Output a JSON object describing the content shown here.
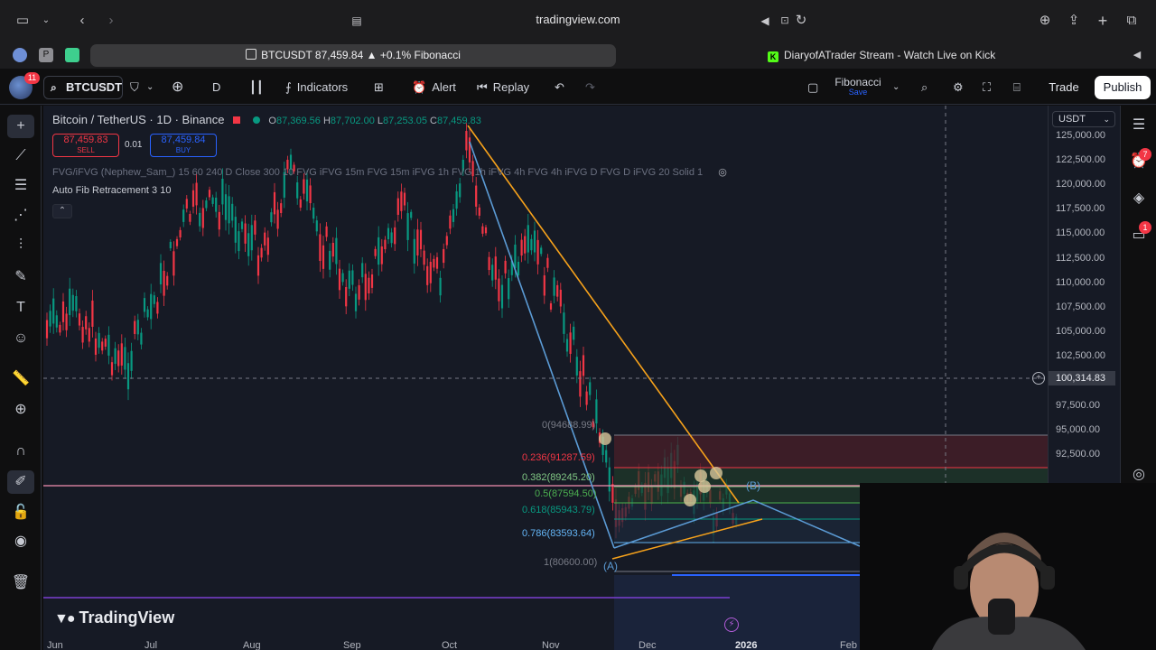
{
  "browser": {
    "url": "tradingview.com",
    "active_tab": "BTCUSDT 87,459.84 ▲ +0.1% Fibonacci",
    "second_tab": "DiaryofATrader Stream - Watch Live on Kick",
    "pinned_tabs": [
      "P"
    ]
  },
  "toolbar": {
    "notifications": "11",
    "symbol": "BTCUSDT",
    "interval": "D",
    "indicators": "Indicators",
    "alert": "Alert",
    "replay": "Replay",
    "layout_name": "Fibonacci",
    "layout_save": "Save",
    "trade": "Trade",
    "publish": "Publish"
  },
  "legend": {
    "title": "Bitcoin / TetherUS · 1D · Binance",
    "open": "87,369.56",
    "high": "87,702.00",
    "low": "87,253.05",
    "close": "87,459.83",
    "o_label": "O",
    "h_label": "H",
    "l_label": "L",
    "c_label": "C",
    "sell_price": "87,459.83",
    "sell_label": "SELL",
    "buy_price": "87,459.84",
    "buy_label": "BUY",
    "spread": "0.01",
    "indicator_1": "FVG/iFVG (Nephew_Sam_) 15 60 240 D Close 300 10 FVG iFVG 15m FVG 15m iFVG 1h FVG 1h iFVG 4h FVG 4h iFVG D FVG D iFVG 20 Solid 1",
    "indicator_2": "Auto Fib Retracement 3 10"
  },
  "fib": {
    "levels": [
      {
        "text": "0(94688.99)",
        "color": "#787b86"
      },
      {
        "text": "0.236(91287.59)",
        "color": "#f23645"
      },
      {
        "text": "0.382(89245.20)",
        "color": "#81c784"
      },
      {
        "text": "0.5(87594.50)",
        "color": "#4caf50"
      },
      {
        "text": "0.618(85943.79)",
        "color": "#089981"
      },
      {
        "text": "0.786(83593.64)",
        "color": "#64b5f6"
      },
      {
        "text": "1(80600.00)",
        "color": "#787b86"
      }
    ]
  },
  "waves": {
    "a": "(A)",
    "b": "(B)"
  },
  "price_axis": {
    "currency": "USDT",
    "labels": [
      "125,000.00",
      "122,500.00",
      "120,000.00",
      "117,500.00",
      "115,000.00",
      "112,500.00",
      "110,000.00",
      "107,500.00",
      "105,000.00",
      "102,500.00",
      "97,500.00",
      "95,000.00",
      "92,500.00"
    ],
    "crosshair": "100,314.83"
  },
  "time_axis": [
    "Jun",
    "Jul",
    "Aug",
    "Sep",
    "Oct",
    "Nov",
    "Dec",
    "2026",
    "Feb"
  ],
  "right_panel": {
    "alerts_badge": "7",
    "chat_badge": "1"
  },
  "watermark": "TradingView",
  "colors": {
    "up": "#089981",
    "down": "#f23645",
    "fib_line": "#2962ff",
    "trend_orange": "#f7a21b",
    "trend_blue": "#5b9bd5"
  }
}
